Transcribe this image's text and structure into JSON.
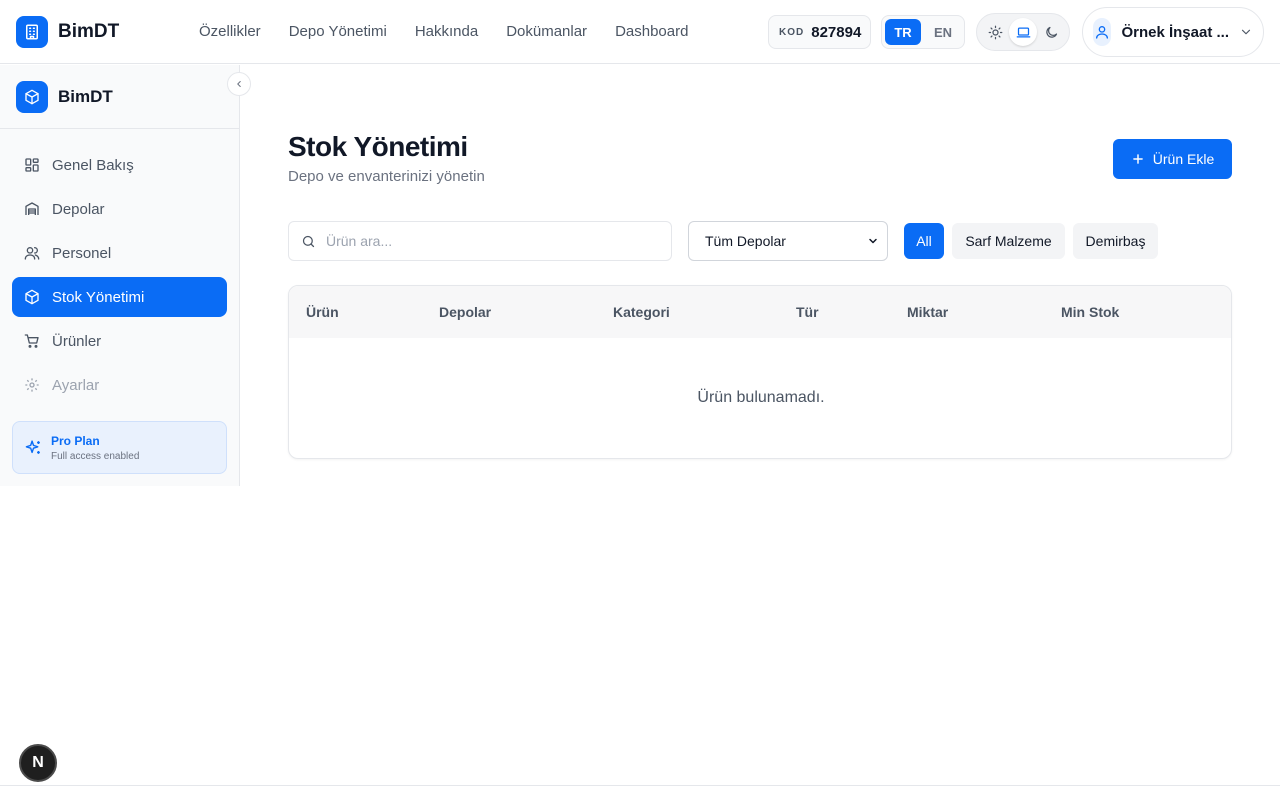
{
  "header": {
    "brand": "BimDT",
    "nav": [
      "Özellikler",
      "Depo Yönetimi",
      "Hakkında",
      "Dokümanlar",
      "Dashboard"
    ],
    "code_label": "KOD",
    "code_value": "827894",
    "languages": [
      "TR",
      "EN"
    ],
    "active_language": "TR",
    "theme_icons": [
      "sun-icon",
      "laptop-icon",
      "moon-icon"
    ],
    "user_name": "Örnek İnşaat ..."
  },
  "sidebar": {
    "brand": "BimDT",
    "items": [
      {
        "label": "Genel Bakış",
        "icon": "grid-icon"
      },
      {
        "label": "Depolar",
        "icon": "warehouse-icon"
      },
      {
        "label": "Personel",
        "icon": "users-icon"
      },
      {
        "label": "Stok Yönetimi",
        "icon": "box-icon",
        "active": true
      },
      {
        "label": "Ürünler",
        "icon": "cart-icon"
      },
      {
        "label": "Ayarlar",
        "icon": "gear-icon",
        "disabled": true
      }
    ],
    "plan": {
      "title": "Pro Plan",
      "subtitle": "Full access enabled"
    }
  },
  "main": {
    "title": "Stok Yönetimi",
    "subtitle": "Depo ve envanterinizi yönetin",
    "add_button": "Ürün Ekle",
    "search_placeholder": "Ürün ara...",
    "warehouse_select": "Tüm Depolar",
    "filters": [
      "All",
      "Sarf Malzeme",
      "Demirbaş"
    ],
    "active_filter": "All",
    "table": {
      "columns": [
        "Ürün",
        "Depolar",
        "Kategori",
        "Tür",
        "Miktar",
        "Min Stok"
      ],
      "empty_text": "Ürün bulunamadı."
    }
  },
  "badge": "N",
  "colors": {
    "accent": "#0a6cf5"
  }
}
